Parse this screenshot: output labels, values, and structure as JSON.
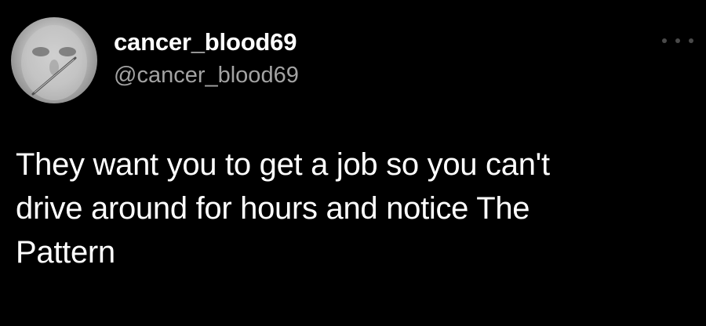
{
  "tweet": {
    "author": {
      "display_name": "cancer_blood69",
      "handle": "@cancer_blood69",
      "avatar_icon": "avatar-photo"
    },
    "more_icon": "more-horizontal-icon",
    "text_lines": [
      "They want you to get a job so you can't",
      "drive around for hours and notice The",
      "Pattern"
    ]
  },
  "colors": {
    "background": "#000000",
    "text_primary": "#ffffff",
    "text_secondary": "#a3a3a3",
    "more_icon": "#4a4a4a"
  }
}
